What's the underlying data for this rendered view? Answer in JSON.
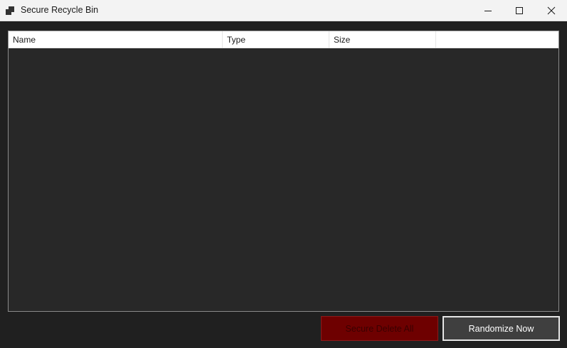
{
  "window": {
    "title": "Secure Recycle Bin"
  },
  "titlebar": {
    "icon": "app-window-icon",
    "minimize_icon": "minimize-icon",
    "maximize_icon": "maximize-icon",
    "close_icon": "close-icon"
  },
  "list": {
    "columns": [
      "Name",
      "Type",
      "Size",
      ""
    ],
    "rows": []
  },
  "actions": {
    "secure_delete_label": "Secure Delete All",
    "randomize_label": "Randomize Now"
  },
  "colors": {
    "background": "#202020",
    "list_background": "#282828",
    "delete_button": "#6e0000",
    "randomize_button": "#3f3f3f"
  }
}
